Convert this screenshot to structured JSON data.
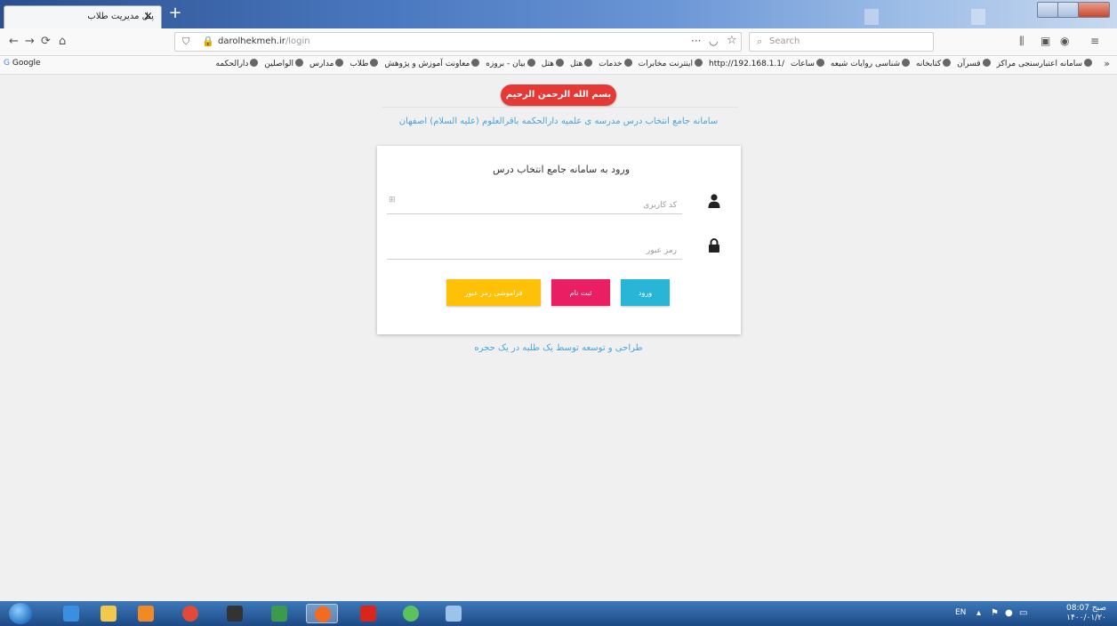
{
  "browser": {
    "tab_title": "پنل مدیریت طلاب",
    "tab_close": "×",
    "new_tab": "+",
    "url_host": "darolhekmeh.ir",
    "url_path": "/login",
    "search_placeholder": "Search"
  },
  "bookmarks": {
    "google": "Google",
    "items": [
      "سامانه اعتبارسنجی مراکز",
      "قسرآن",
      "کتابخانه",
      "شناسی روایات شیعه",
      "ساعات",
      "اینترنت مخابرات",
      "خدمات",
      "هتل",
      "هتل",
      "بیان - بروزه",
      "معاونت آموزش و پژوهش",
      "طلاب",
      "مدارس",
      "الواصلین",
      "دارالحکمه"
    ],
    "ip_link": "http://192.168.1.1/"
  },
  "page": {
    "basmala": "بسم الله الرحمن الرحیم",
    "subtitle": "سامانه جامع انتخاب درس مدرسه ی علمیه دارالحکمه باقرالعلوم (علیه السلام) اصفهان",
    "login_title": "ورود به سامانه جامع انتخاب درس",
    "username_placeholder": "کد کاربری",
    "password_placeholder": "رمز عبور",
    "login_button": "ورود",
    "register_button": "ثبت نام",
    "forgot_button": "فراموشی رمز عبور",
    "footer": "طراحی و توسعه توسط یک طلبه در یک حجره"
  },
  "taskbar": {
    "lang": "EN",
    "clock_line1": "صبح 08:07",
    "clock_line2": "۱۴۰۰/۰۱/۲۰"
  },
  "colors": {
    "basmala": "#e53935",
    "login": "#29b6d6",
    "register": "#e91e63",
    "forgot": "#ffc107",
    "link": "#4aa3df"
  }
}
